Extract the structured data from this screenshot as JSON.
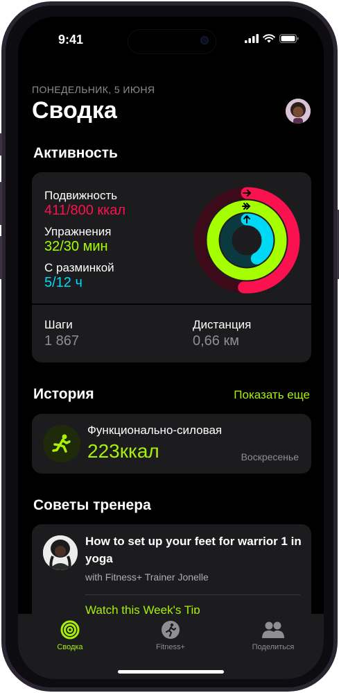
{
  "status_bar": {
    "time": "9:41"
  },
  "header": {
    "date": "ПОНЕДЕЛЬНИК, 5 ИЮНЯ",
    "title": "Сводка"
  },
  "activity": {
    "section_title": "Активность",
    "move": {
      "label": "Подвижность",
      "value": "411/800 ккал",
      "color": "#fa114f",
      "progress": 0.51
    },
    "exercise": {
      "label": "Упражнения",
      "value": "32/30 мин",
      "color": "#a6ff00",
      "progress": 1.07
    },
    "stand": {
      "label": "С разминкой",
      "value": "5/12 ч",
      "color": "#00d9f5",
      "progress": 0.42
    },
    "steps": {
      "label": "Шаги",
      "value": "1 867"
    },
    "distance": {
      "label": "Дистанция",
      "value": "0,66 км"
    }
  },
  "history": {
    "section_title": "История",
    "show_more": "Показать еще",
    "workout": {
      "name": "Функционально-силовая",
      "calories": "223ккал",
      "day": "Воскресенье",
      "icon": "functional-strength-icon"
    }
  },
  "coach_tips": {
    "section_title": "Советы тренера",
    "title": "How to set up your feet for warrior 1 in yoga",
    "subtitle": "with Fitness+ Trainer Jonelle",
    "link": "Watch this Week's Tip"
  },
  "tabbar": {
    "tabs": [
      {
        "label": "Сводка",
        "icon": "activity-rings-icon",
        "active": true
      },
      {
        "label": "Fitness+",
        "icon": "fitness-plus-icon",
        "active": false
      },
      {
        "label": "Поделиться",
        "icon": "sharing-icon",
        "active": false
      }
    ]
  },
  "colors": {
    "accent": "#a8f00a",
    "secondary_text": "#8e8e93",
    "card": "#1c1c1e"
  }
}
